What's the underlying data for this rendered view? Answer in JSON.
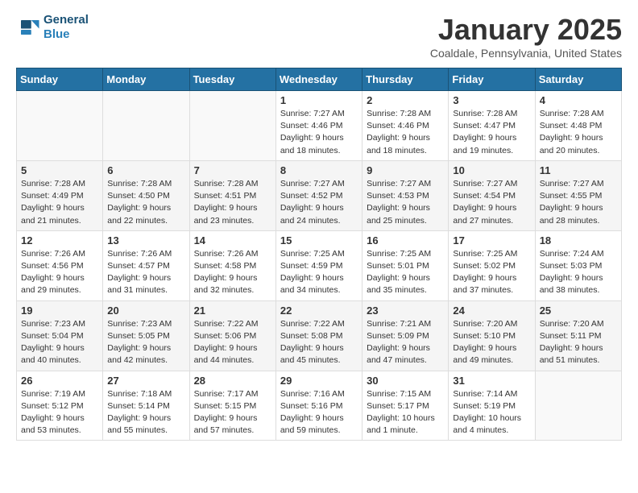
{
  "header": {
    "logo_line1": "General",
    "logo_line2": "Blue",
    "month": "January 2025",
    "location": "Coaldale, Pennsylvania, United States"
  },
  "weekdays": [
    "Sunday",
    "Monday",
    "Tuesday",
    "Wednesday",
    "Thursday",
    "Friday",
    "Saturday"
  ],
  "weeks": [
    [
      {
        "day": "",
        "info": ""
      },
      {
        "day": "",
        "info": ""
      },
      {
        "day": "",
        "info": ""
      },
      {
        "day": "1",
        "info": "Sunrise: 7:27 AM\nSunset: 4:46 PM\nDaylight: 9 hours\nand 18 minutes."
      },
      {
        "day": "2",
        "info": "Sunrise: 7:28 AM\nSunset: 4:46 PM\nDaylight: 9 hours\nand 18 minutes."
      },
      {
        "day": "3",
        "info": "Sunrise: 7:28 AM\nSunset: 4:47 PM\nDaylight: 9 hours\nand 19 minutes."
      },
      {
        "day": "4",
        "info": "Sunrise: 7:28 AM\nSunset: 4:48 PM\nDaylight: 9 hours\nand 20 minutes."
      }
    ],
    [
      {
        "day": "5",
        "info": "Sunrise: 7:28 AM\nSunset: 4:49 PM\nDaylight: 9 hours\nand 21 minutes."
      },
      {
        "day": "6",
        "info": "Sunrise: 7:28 AM\nSunset: 4:50 PM\nDaylight: 9 hours\nand 22 minutes."
      },
      {
        "day": "7",
        "info": "Sunrise: 7:28 AM\nSunset: 4:51 PM\nDaylight: 9 hours\nand 23 minutes."
      },
      {
        "day": "8",
        "info": "Sunrise: 7:27 AM\nSunset: 4:52 PM\nDaylight: 9 hours\nand 24 minutes."
      },
      {
        "day": "9",
        "info": "Sunrise: 7:27 AM\nSunset: 4:53 PM\nDaylight: 9 hours\nand 25 minutes."
      },
      {
        "day": "10",
        "info": "Sunrise: 7:27 AM\nSunset: 4:54 PM\nDaylight: 9 hours\nand 27 minutes."
      },
      {
        "day": "11",
        "info": "Sunrise: 7:27 AM\nSunset: 4:55 PM\nDaylight: 9 hours\nand 28 minutes."
      }
    ],
    [
      {
        "day": "12",
        "info": "Sunrise: 7:26 AM\nSunset: 4:56 PM\nDaylight: 9 hours\nand 29 minutes."
      },
      {
        "day": "13",
        "info": "Sunrise: 7:26 AM\nSunset: 4:57 PM\nDaylight: 9 hours\nand 31 minutes."
      },
      {
        "day": "14",
        "info": "Sunrise: 7:26 AM\nSunset: 4:58 PM\nDaylight: 9 hours\nand 32 minutes."
      },
      {
        "day": "15",
        "info": "Sunrise: 7:25 AM\nSunset: 4:59 PM\nDaylight: 9 hours\nand 34 minutes."
      },
      {
        "day": "16",
        "info": "Sunrise: 7:25 AM\nSunset: 5:01 PM\nDaylight: 9 hours\nand 35 minutes."
      },
      {
        "day": "17",
        "info": "Sunrise: 7:25 AM\nSunset: 5:02 PM\nDaylight: 9 hours\nand 37 minutes."
      },
      {
        "day": "18",
        "info": "Sunrise: 7:24 AM\nSunset: 5:03 PM\nDaylight: 9 hours\nand 38 minutes."
      }
    ],
    [
      {
        "day": "19",
        "info": "Sunrise: 7:23 AM\nSunset: 5:04 PM\nDaylight: 9 hours\nand 40 minutes."
      },
      {
        "day": "20",
        "info": "Sunrise: 7:23 AM\nSunset: 5:05 PM\nDaylight: 9 hours\nand 42 minutes."
      },
      {
        "day": "21",
        "info": "Sunrise: 7:22 AM\nSunset: 5:06 PM\nDaylight: 9 hours\nand 44 minutes."
      },
      {
        "day": "22",
        "info": "Sunrise: 7:22 AM\nSunset: 5:08 PM\nDaylight: 9 hours\nand 45 minutes."
      },
      {
        "day": "23",
        "info": "Sunrise: 7:21 AM\nSunset: 5:09 PM\nDaylight: 9 hours\nand 47 minutes."
      },
      {
        "day": "24",
        "info": "Sunrise: 7:20 AM\nSunset: 5:10 PM\nDaylight: 9 hours\nand 49 minutes."
      },
      {
        "day": "25",
        "info": "Sunrise: 7:20 AM\nSunset: 5:11 PM\nDaylight: 9 hours\nand 51 minutes."
      }
    ],
    [
      {
        "day": "26",
        "info": "Sunrise: 7:19 AM\nSunset: 5:12 PM\nDaylight: 9 hours\nand 53 minutes."
      },
      {
        "day": "27",
        "info": "Sunrise: 7:18 AM\nSunset: 5:14 PM\nDaylight: 9 hours\nand 55 minutes."
      },
      {
        "day": "28",
        "info": "Sunrise: 7:17 AM\nSunset: 5:15 PM\nDaylight: 9 hours\nand 57 minutes."
      },
      {
        "day": "29",
        "info": "Sunrise: 7:16 AM\nSunset: 5:16 PM\nDaylight: 9 hours\nand 59 minutes."
      },
      {
        "day": "30",
        "info": "Sunrise: 7:15 AM\nSunset: 5:17 PM\nDaylight: 10 hours\nand 1 minute."
      },
      {
        "day": "31",
        "info": "Sunrise: 7:14 AM\nSunset: 5:19 PM\nDaylight: 10 hours\nand 4 minutes."
      },
      {
        "day": "",
        "info": ""
      }
    ]
  ]
}
